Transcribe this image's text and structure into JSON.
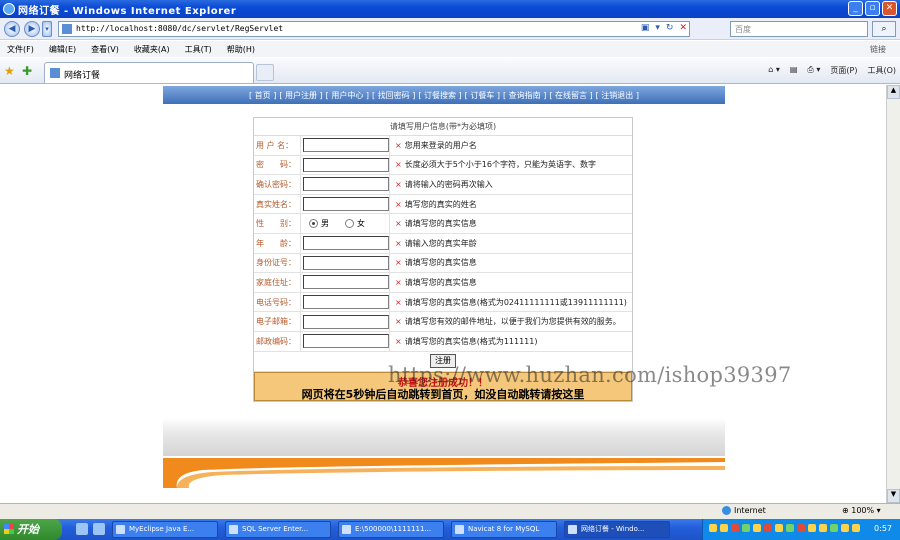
{
  "window": {
    "title": "网络订餐 - Windows Internet Explorer"
  },
  "address_bar": {
    "url": "http://localhost:8080/dc/servlet/RegServlet"
  },
  "search": {
    "placeholder": "百度"
  },
  "menu": {
    "items": [
      "文件(F)",
      "编辑(E)",
      "查看(V)",
      "收藏夹(A)",
      "工具(T)",
      "帮助(H)"
    ],
    "links_label": "链接"
  },
  "tab": {
    "label": "网络订餐"
  },
  "command_bar": {
    "page": "页面(P)",
    "tools": "工具(O)"
  },
  "site_nav": {
    "items": [
      "[ 首页 ]",
      "[ 用户注册 ]",
      "[ 用户中心 ]",
      "[ 找回密码 ]",
      "[ 订餐搜索 ]",
      "[ 订餐车 ]",
      "[ 查询指南 ]",
      "[ 在线留言 ]",
      "[ 注销退出 ]"
    ]
  },
  "form": {
    "header": "请填写用户信息(带*为必填项)",
    "rows": [
      {
        "label": "用 户 名：",
        "hint": "您用来登录的用户名"
      },
      {
        "label": "密　　码：",
        "hint": "长度必须大于5个小于16个字符，只能为英语字、数字"
      },
      {
        "label": "确认密码：",
        "hint": "请将输入的密码再次输入"
      },
      {
        "label": "真实姓名：",
        "hint": "填写您的真实的姓名"
      },
      {
        "label": "性　　别：",
        "hint": "请填写您的真实信息",
        "radio": [
          "男",
          "女"
        ]
      },
      {
        "label": "年　　龄：",
        "hint": "请输入您的真实年龄"
      },
      {
        "label": "身份证号：",
        "hint": "请填写您的真实信息"
      },
      {
        "label": "家庭住址：",
        "hint": "请填写您的真实信息"
      },
      {
        "label": "电话号码：",
        "hint": "请填写您的真实信息(格式为02411111111或13911111111)"
      },
      {
        "label": "电子邮箱：",
        "hint": "请填写您有效的邮件地址，以便于我们为您提供有效的服务。"
      },
      {
        "label": "邮政编码：",
        "hint": "请填写您的真实信息(格式为111111)"
      }
    ],
    "submit_label": "注册",
    "success_text": "恭喜您注册成功！！",
    "redirect_text": "网页将在5秒钟后自动跳转到首页，如没自动跳转请按这里"
  },
  "watermark": "https://www.huzhan.com/ishop39397",
  "status_bar": {
    "zone": "Internet",
    "zoom": "100%"
  },
  "taskbar": {
    "start": "开始",
    "tasks": [
      "MyEclipse Java E...",
      "SQL Server Enter...",
      "E:\\500000\\1111111...",
      "Navicat 8 for MySQL",
      "网络订餐 - Windo..."
    ],
    "clock": "0:57"
  }
}
